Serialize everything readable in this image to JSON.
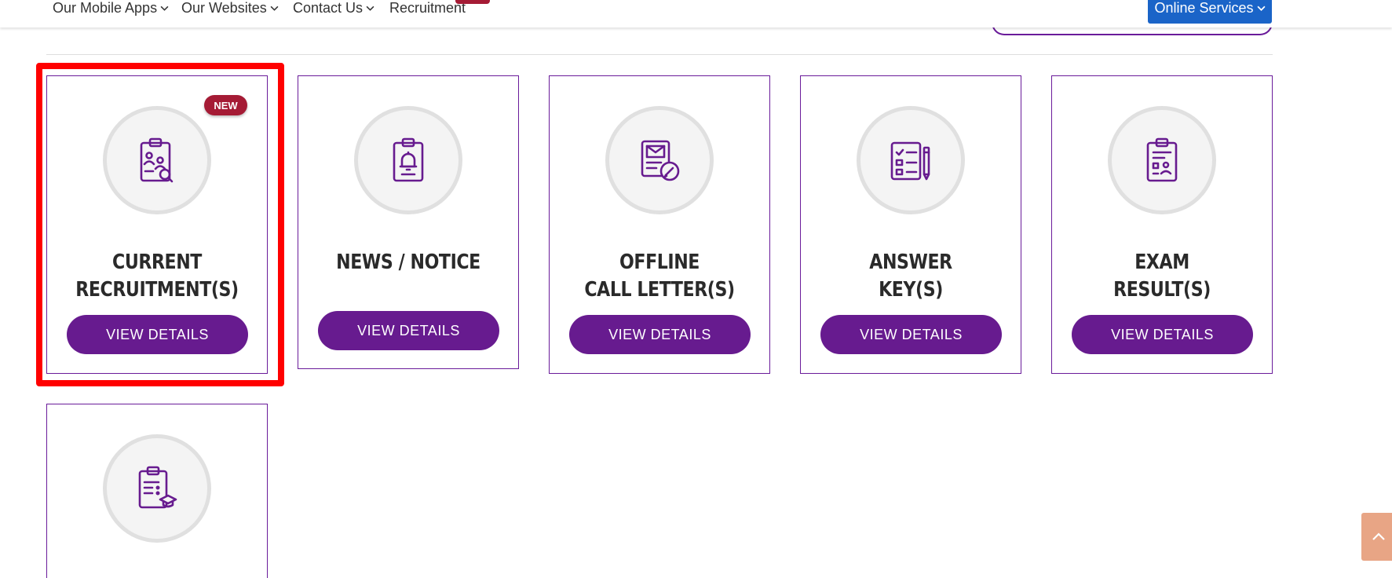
{
  "nav": {
    "items": [
      {
        "label": "Our Mobile Apps"
      },
      {
        "label": "Our Websites"
      },
      {
        "label": "Contact Us"
      },
      {
        "label": "Recruitment"
      }
    ],
    "online_services": "Online Services"
  },
  "cards": [
    {
      "title_line1": "CURRENT",
      "title_line2": "RECRUITMENT(S)",
      "button": "VIEW DETAILS",
      "badge": "NEW",
      "icon": "recruitment-clipboard-icon"
    },
    {
      "title_line1": "NEWS / NOTICE",
      "title_line2": "",
      "button": "VIEW DETAILS",
      "icon": "notice-bell-clipboard-icon"
    },
    {
      "title_line1": "OFFLINE",
      "title_line2": "CALL LETTER(S)",
      "button": "VIEW DETAILS",
      "icon": "call-letter-envelope-icon"
    },
    {
      "title_line1": "ANSWER",
      "title_line2": "KEY(S)",
      "button": "VIEW DETAILS",
      "icon": "answer-key-checklist-icon"
    },
    {
      "title_line1": "EXAM",
      "title_line2": "RESULT(S)",
      "button": "VIEW DETAILS",
      "icon": "exam-result-clipboard-icon"
    },
    {
      "icon": "education-clipboard-icon"
    }
  ],
  "colors": {
    "brand_purple": "#671b8f",
    "badge_red": "#a51b35",
    "online_blue": "#1a64c8",
    "highlight_red": "#ff0000"
  }
}
